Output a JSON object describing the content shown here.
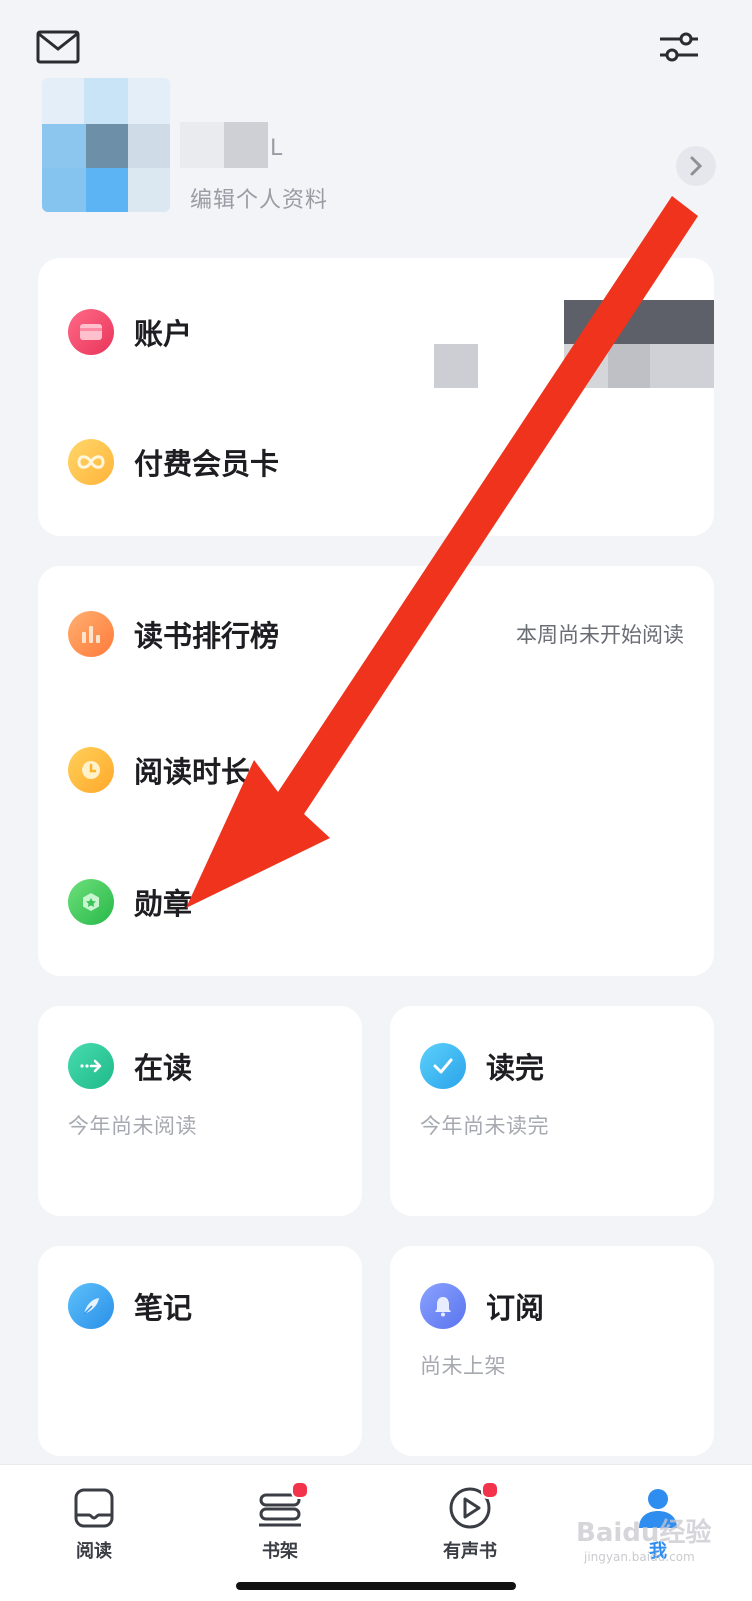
{
  "header": {
    "mail_icon": "mail-icon",
    "settings_icon": "sliders-icon"
  },
  "profile": {
    "edit_label": "编辑个人资料",
    "name_suffix": "L"
  },
  "card_account": {
    "items": [
      {
        "label": "账户",
        "icon": "wallet-icon",
        "color": "#f2406a"
      },
      {
        "label": "付费会员卡",
        "icon": "infinity-icon",
        "color": "#ffc34a"
      }
    ]
  },
  "card_reading": {
    "items": [
      {
        "label": "读书排行榜",
        "right": "本周尚未开始阅读",
        "icon": "bar-chart-icon",
        "color": "#ff8a3d"
      },
      {
        "label": "阅读时长",
        "icon": "clock-icon",
        "color": "#ffb327"
      },
      {
        "label": "勋章",
        "icon": "medal-icon",
        "color": "#37c85a"
      }
    ]
  },
  "tiles": [
    {
      "title": "在读",
      "sub": "今年尚未阅读",
      "icon": "arrow-right-icon",
      "color": "#2ec99a"
    },
    {
      "title": "读完",
      "sub": "今年尚未读完",
      "icon": "check-icon",
      "color": "#38b6ef"
    },
    {
      "title": "笔记",
      "sub": "",
      "icon": "feather-icon",
      "color": "#3aa2f0"
    },
    {
      "title": "订阅",
      "sub": "尚未上架",
      "icon": "bell-icon",
      "color": "#6b86f5"
    }
  ],
  "tabbar": {
    "tabs": [
      {
        "label": "阅读",
        "icon": "book-icon",
        "badge": false
      },
      {
        "label": "书架",
        "icon": "bookshelf-icon",
        "badge": true
      },
      {
        "label": "有声书",
        "icon": "play-circle-icon",
        "badge": true
      },
      {
        "label": "我",
        "icon": "person-icon",
        "badge": false,
        "active": true
      }
    ]
  },
  "watermark": {
    "brand": "Baidu经验",
    "url": "jingyan.baidu.com"
  },
  "colors": {
    "background": "#f3f4f8",
    "card": "#ffffff",
    "accent": "#2f8df0",
    "annotation_arrow": "#f0331c",
    "badge": "#f2334b"
  }
}
